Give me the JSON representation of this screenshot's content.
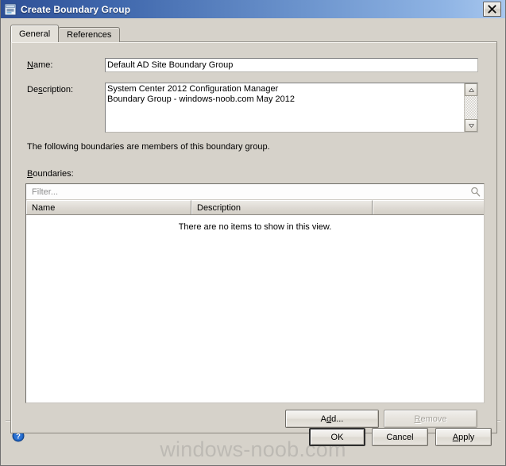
{
  "window": {
    "title": "Create Boundary Group",
    "icon": "form-window-icon",
    "close_label": "×"
  },
  "tabs": [
    {
      "label": "General",
      "active": true
    },
    {
      "label": "References",
      "active": false
    }
  ],
  "general": {
    "name_label_pre": "",
    "name_label_accel": "N",
    "name_label_post": "ame:",
    "name_value": "Default AD Site Boundary Group",
    "description_label_pre": "De",
    "description_label_accel": "s",
    "description_label_post": "cription:",
    "description_value": "System Center 2012 Configuration Manager\nBoundary Group - windows-noob.com May 2012",
    "note": "The following boundaries are members of this boundary group.",
    "boundaries_label_pre": "",
    "boundaries_label_accel": "B",
    "boundaries_label_post": "oundaries:",
    "filter_placeholder": "Filter...",
    "filter_value": "",
    "search_icon": "search-icon",
    "columns": [
      "Name",
      "Description",
      ""
    ],
    "rows": [],
    "empty_message": "There are no items to show in this view.",
    "add_button_pre": "A",
    "add_button_accel": "d",
    "add_button_post": "d...",
    "remove_button_pre": "",
    "remove_button_accel": "R",
    "remove_button_post": "emove",
    "remove_disabled": true
  },
  "footer": {
    "help_icon": "help-icon",
    "watermark": "windows-noob.com",
    "ok_label": "OK",
    "cancel_label": "Cancel",
    "apply_label_pre": "",
    "apply_label_accel": "A",
    "apply_label_post": "pply"
  },
  "colors": {
    "titlebar_left": "#2e4f96",
    "titlebar_right": "#a8c7ee",
    "dialog_face": "#d6d2ca",
    "help_blue": "#1b5fbe",
    "watermark_grey": "#bdbab4"
  }
}
